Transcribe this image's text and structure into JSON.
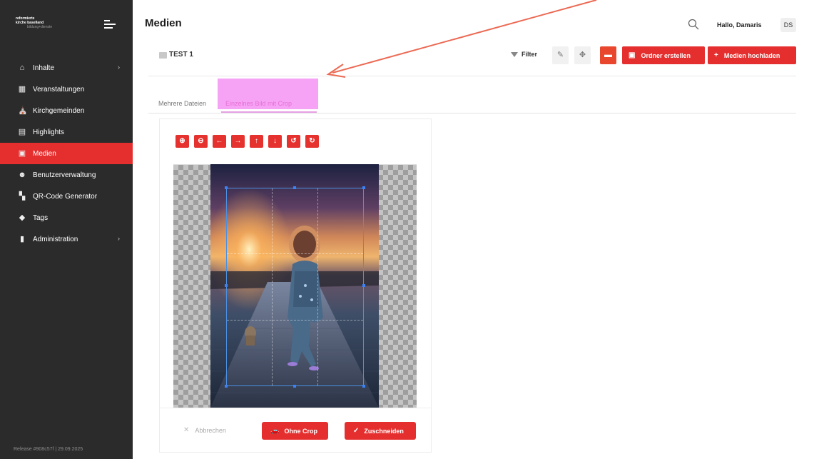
{
  "brand": {
    "logo_line1": "reformierte",
    "logo_line2": "kirche baselland",
    "logo_line3": "bildung+dienste"
  },
  "sidebar": {
    "items": [
      {
        "label": "Inhalte",
        "icon": "home-icon",
        "has_chevron": true
      },
      {
        "label": "Veranstaltungen",
        "icon": "calendar-icon"
      },
      {
        "label": "Kirchgemeinden",
        "icon": "church-icon"
      },
      {
        "label": "Highlights",
        "icon": "newspaper-icon"
      },
      {
        "label": "Medien",
        "icon": "image-icon",
        "active": true
      },
      {
        "label": "Benutzerverwaltung",
        "icon": "users-icon"
      },
      {
        "label": "QR-Code Generator",
        "icon": "qr-icon"
      },
      {
        "label": "Tags",
        "icon": "tag-icon"
      },
      {
        "label": "Administration",
        "icon": "clipboard-icon",
        "has_chevron": true
      }
    ],
    "chevron": "›",
    "release": "Release #908c57f | 29.09.2025"
  },
  "header": {
    "title": "Medien",
    "greeting_prefix": "Hallo,",
    "user_name": "Damaris",
    "avatar_initials": "DS"
  },
  "folder": {
    "name": "TEST 1",
    "filter_label": "Filter",
    "create_folder_label": "Ordner erstellen",
    "upload_label": "Medien hochladen"
  },
  "tabs": [
    {
      "label": "Mehrere Dateien"
    },
    {
      "label": "Einzelnes Bild mit Crop",
      "active": true
    }
  ],
  "cropper": {
    "tools": [
      {
        "name": "zoom-in-icon",
        "glyph": "⊕"
      },
      {
        "name": "zoom-out-icon",
        "glyph": "⊖"
      },
      {
        "name": "arrow-left-icon",
        "glyph": "←"
      },
      {
        "name": "arrow-right-icon",
        "glyph": "→"
      },
      {
        "name": "arrow-up-icon",
        "glyph": "↑"
      },
      {
        "name": "arrow-down-icon",
        "glyph": "↓"
      },
      {
        "name": "rotate-left-icon",
        "glyph": "↺"
      },
      {
        "name": "rotate-right-icon",
        "glyph": "↻"
      }
    ],
    "cancel_label": "Abbrechen",
    "no_crop_label": "Ohne Crop",
    "crop_label": "Zuschneiden"
  },
  "colors": {
    "accent": "#e52f2f",
    "sidebar_bg": "#2b2b2b",
    "annotation_highlight": "#f6a3f6",
    "annotation_arrow": "#ec6a54"
  }
}
